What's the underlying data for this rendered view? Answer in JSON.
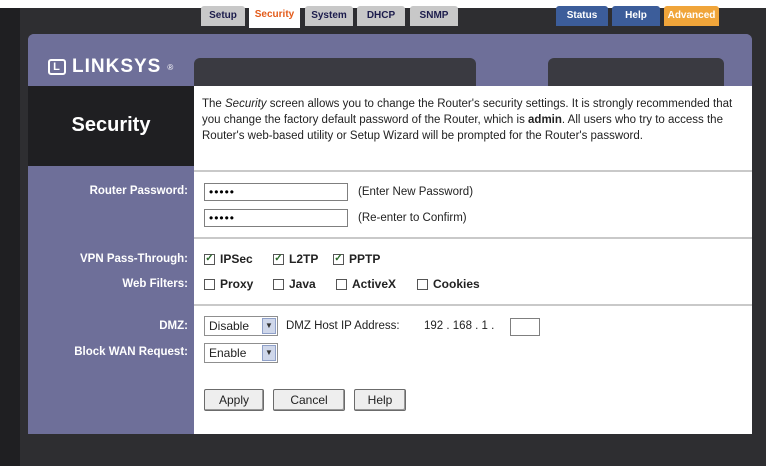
{
  "brand": {
    "name": "LINKSYS",
    "mark": "L",
    "registered": "®"
  },
  "tabs": [
    {
      "label": "Setup",
      "active": false
    },
    {
      "label": "Security",
      "active": true
    },
    {
      "label": "System",
      "active": false
    },
    {
      "label": "DHCP",
      "active": false
    },
    {
      "label": "SNMP",
      "active": false
    }
  ],
  "right_tabs": [
    {
      "label": "Status"
    },
    {
      "label": "Help"
    },
    {
      "label": "Advanced"
    }
  ],
  "page_title": "Security",
  "description": {
    "part1": "The ",
    "emph": "Security",
    "part2": " screen allows you to change the Router's security settings. It is strongly recommended that you change the factory default password of the Router, which is ",
    "bold": "admin",
    "part3": ". All users who try to access the Router's web-based utility or Setup Wizard will be prompted for the Router's password."
  },
  "router_password": {
    "label": "Router Password:",
    "value": "•••••",
    "confirm_value": "•••••",
    "hint_new": "(Enter New Password)",
    "hint_confirm": "(Re-enter to Confirm)"
  },
  "vpn": {
    "label": "VPN Pass-Through:",
    "options": [
      {
        "label": "IPSec",
        "checked": true
      },
      {
        "label": "L2TP",
        "checked": true
      },
      {
        "label": "PPTP",
        "checked": true
      }
    ]
  },
  "web_filters": {
    "label": "Web Filters:",
    "options": [
      {
        "label": "Proxy",
        "checked": false
      },
      {
        "label": "Java",
        "checked": false
      },
      {
        "label": "ActiveX",
        "checked": false
      },
      {
        "label": "Cookies",
        "checked": false
      }
    ]
  },
  "dmz": {
    "label": "DMZ:",
    "selected": "Disable",
    "host_label": "DMZ Host IP Address:",
    "ip_prefix": "192 . 168 . 1 .",
    "ip_last": ""
  },
  "block_wan": {
    "label": "Block WAN Request:",
    "selected": "Enable"
  },
  "buttons": {
    "apply": "Apply",
    "cancel": "Cancel",
    "help": "Help"
  },
  "colors": {
    "panel": "#6e6f99",
    "dark": "#1f1f22",
    "active_tab_text": "#e35b1a",
    "blue_tab": "#3c5d9a",
    "advanced_tab": "#f0a53a"
  }
}
